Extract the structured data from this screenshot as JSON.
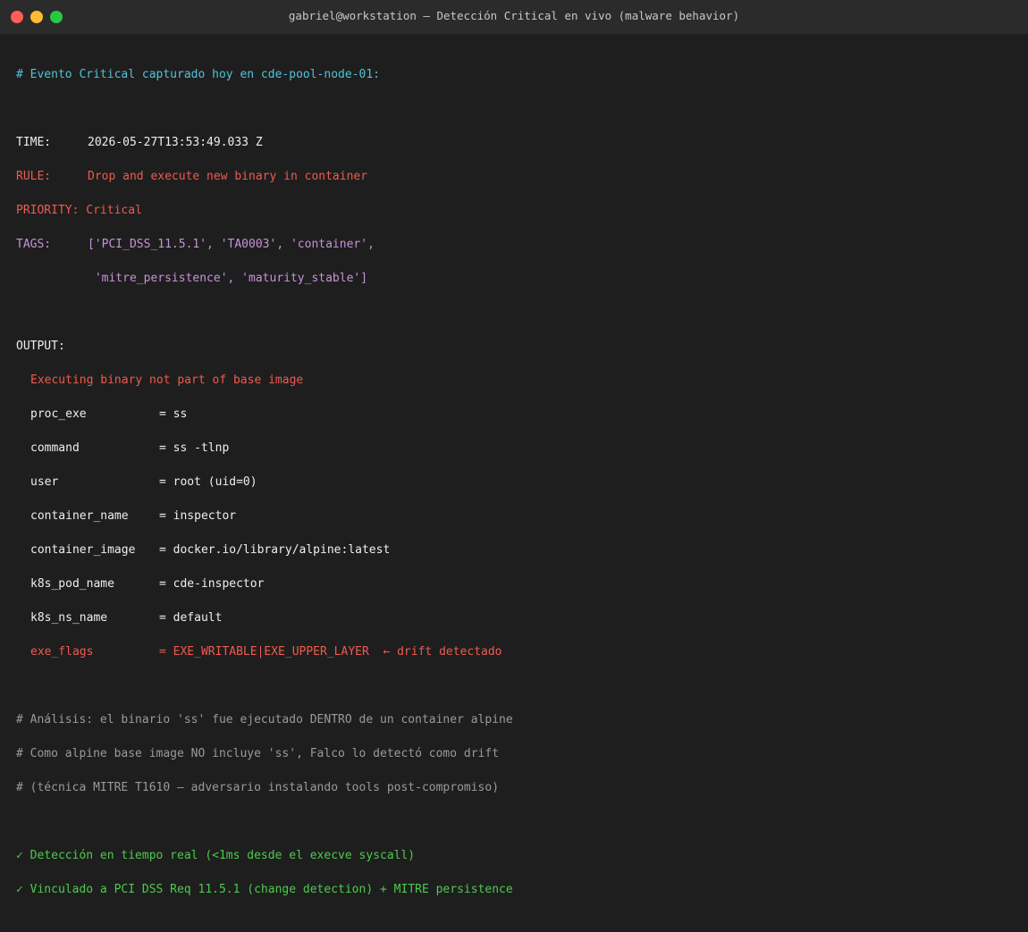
{
  "window": {
    "title": "gabriel@workstation — Detección Critical en vivo (malware behavior)",
    "colors": {
      "close": "#ff5f57",
      "minimize": "#febc2e",
      "maximize": "#28c840"
    }
  },
  "terminal": {
    "header_comment": "# Evento Critical capturado hoy en cde-pool-node-01:",
    "time_key": "TIME:",
    "time_val": "2026-05-27T13:53:49.033 Z",
    "rule_key": "RULE:",
    "rule_val": "Drop and execute new binary in container",
    "priority_key": "PRIORITY:",
    "priority_val": "Critical",
    "tags_key": "TAGS:",
    "tags_line1": "['PCI_DSS_11.5.1', 'TA0003', 'container',",
    "tags_line2": " 'mitre_persistence', 'maturity_stable']",
    "output_key": "OUTPUT:",
    "output_message": "Executing binary not part of base image",
    "fields": [
      {
        "key": "proc_exe",
        "value": "= ss"
      },
      {
        "key": "command",
        "value": "= ss -tlnp"
      },
      {
        "key": "user",
        "value": "= root (uid=0)"
      },
      {
        "key": "container_name",
        "value": "= inspector"
      },
      {
        "key": "container_image",
        "value": "= docker.io/library/alpine:latest"
      },
      {
        "key": "k8s_pod_name",
        "value": "= cde-inspector"
      },
      {
        "key": "k8s_ns_name",
        "value": "= default"
      },
      {
        "key": "exe_flags",
        "value": "= EXE_WRITABLE|EXE_UPPER_LAYER  ← drift detectado"
      }
    ],
    "analysis": [
      "# Análisis: el binario 'ss' fue ejecutado DENTRO de un container alpine",
      "# Como alpine base image NO incluye 'ss', Falco lo detectó como drift",
      "# (técnica MITRE T1610 — adversario instalando tools post-compromiso)"
    ],
    "checks": [
      "✓ Detección en tiempo real (<1ms desde el execve syscall)",
      "✓ Vinculado a PCI DSS Req 11.5.1 (change detection) + MITRE persistence"
    ]
  }
}
